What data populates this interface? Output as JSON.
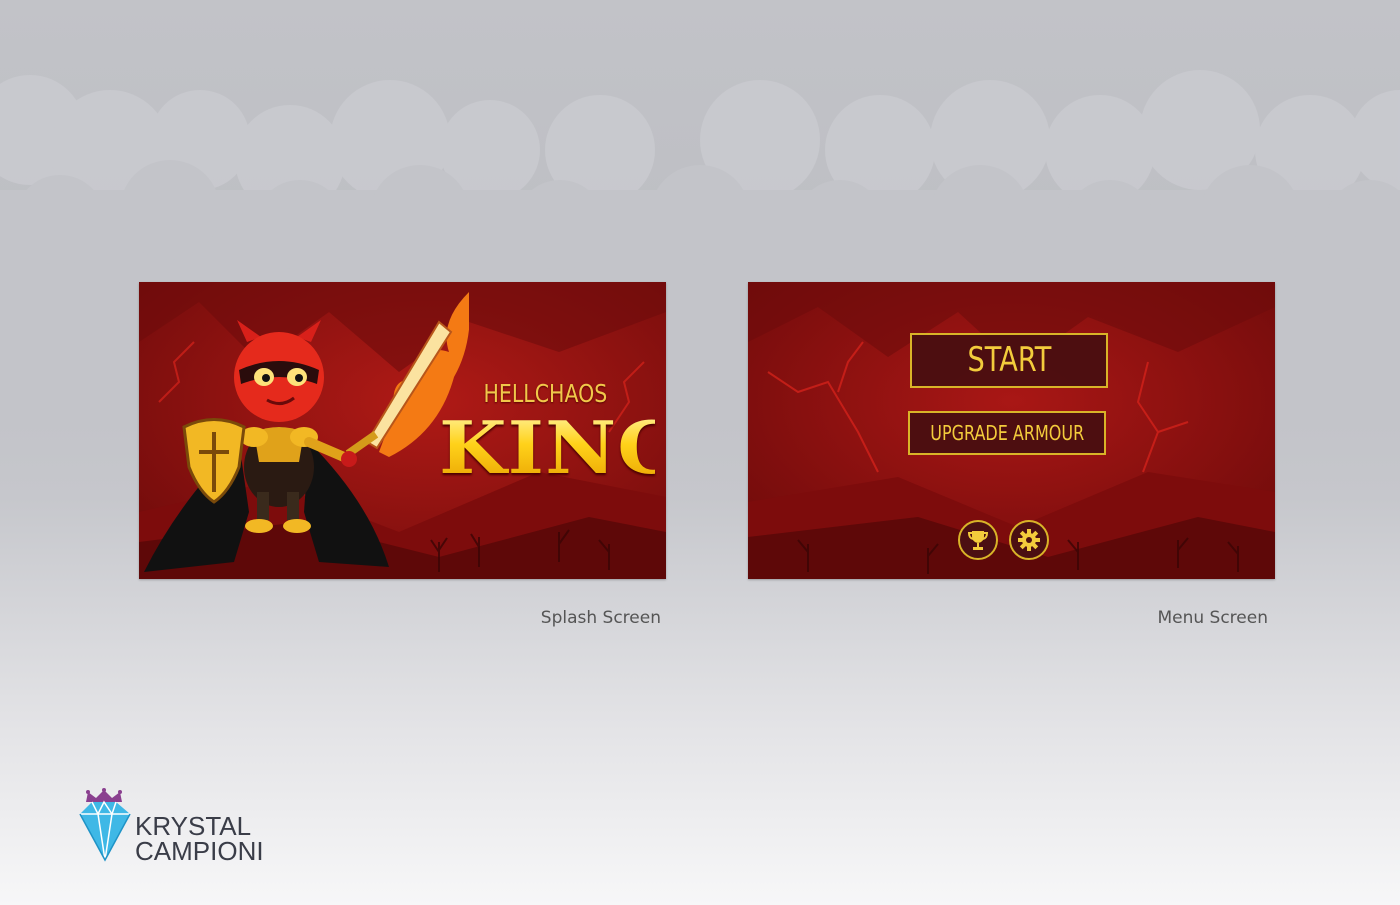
{
  "splash": {
    "title_small": "HELLCHAOS",
    "title_big": "KING",
    "caption": "Splash Screen"
  },
  "menu": {
    "start_label": "START",
    "upgrade_label": "UPGRADE ARMOUR",
    "trophy_icon": "trophy-icon",
    "settings_icon": "gear-icon",
    "caption": "Menu Screen"
  },
  "branding": {
    "line1": "KRYSTAL",
    "line2": "CAMPIONI"
  },
  "colors": {
    "background_red": "#8e0f0f",
    "accent_gold": "#f3cc3c",
    "button_fill": "#460e10",
    "logo_diamond": "#3fb8e6",
    "logo_crown": "#8a3f8f"
  }
}
